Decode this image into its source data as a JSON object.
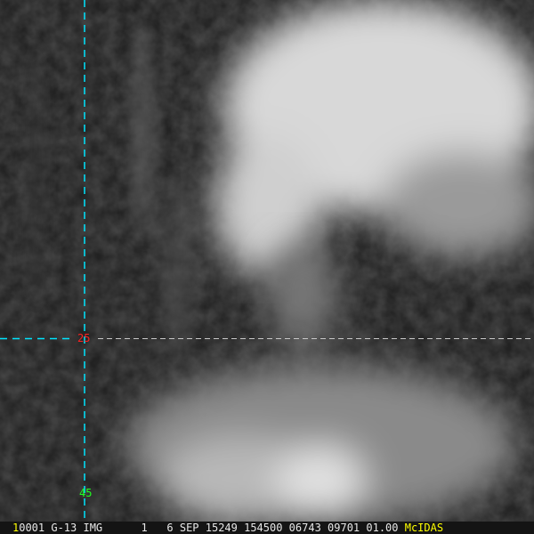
{
  "image": {
    "grid_labels": {
      "latitude": "25",
      "longitude": "45"
    },
    "status_bar": {
      "frame": "1",
      "text": "0001 G-13 IMG      1   6 SEP 15249 154500 06743 09701 01.00",
      "brand": "McIDAS"
    },
    "colors": {
      "grid_cyan": "#00e5ff",
      "lat_label": "#ff2020",
      "lon_label": "#20ff20",
      "brand": "#ffff00"
    }
  }
}
